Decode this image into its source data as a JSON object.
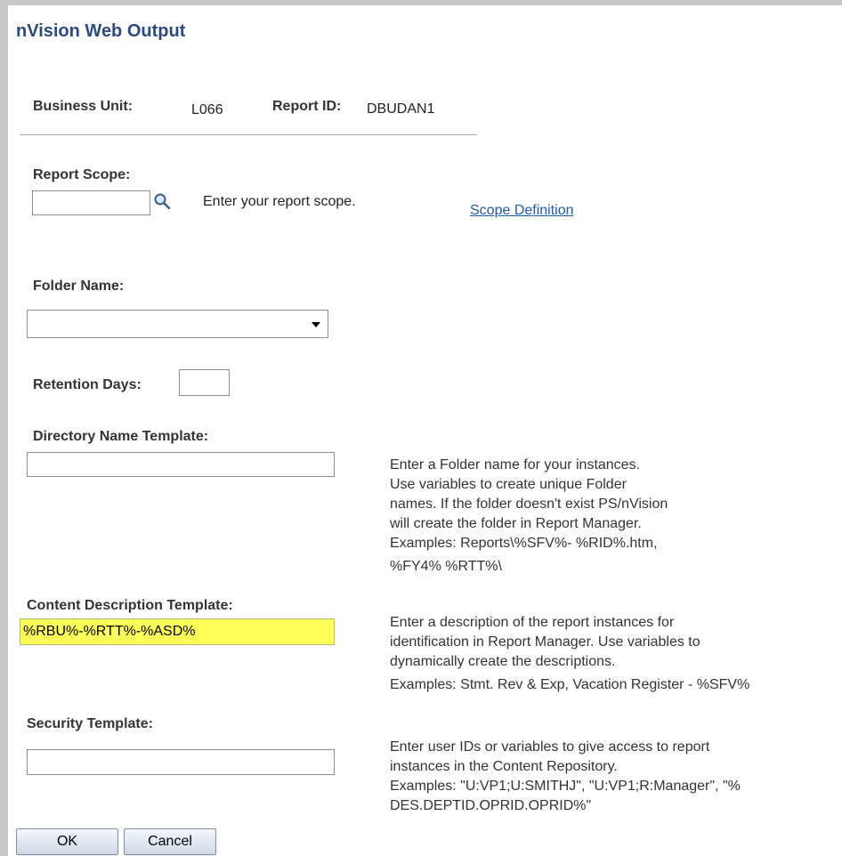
{
  "page": {
    "title": "nVision Web Output"
  },
  "header": {
    "business_unit_label": "Business Unit:",
    "business_unit_value": "L066",
    "report_id_label": "Report ID:",
    "report_id_value": "DBUDAN1"
  },
  "report_scope": {
    "label": "Report Scope:",
    "value": "",
    "hint": "Enter your report scope.",
    "link": "Scope Definition"
  },
  "folder_name": {
    "label": "Folder Name:",
    "selected": ""
  },
  "retention_days": {
    "label": "Retention Days:",
    "value": ""
  },
  "directory_template": {
    "label": "Directory Name Template:",
    "value": "",
    "help": [
      "Enter a Folder name for your instances.",
      "Use variables to create unique Folder",
      "names. If the folder doesn't exist PS/nVision",
      "will create the folder in Report Manager.",
      "Examples: Reports\\%SFV%- %RID%.htm,",
      "%FY4% %RTT%\\"
    ]
  },
  "content_description_template": {
    "label": "Content Description Template:",
    "value": "%RBU%-%RTT%-%ASD%",
    "help": [
      "Enter a description of the report instances for",
      "identification in Report Manager. Use variables to",
      "dynamically create the descriptions.",
      "Examples: Stmt. Rev & Exp, Vacation Register - %SFV%"
    ]
  },
  "security_template": {
    "label": "Security Template:",
    "value": "",
    "help": [
      "Enter user IDs or variables to give access to report",
      "instances in the Content Repository.",
      "Examples: \"U:VP1;U:SMITHJ\", \"U:VP1;R:Manager\", \"%",
      "DES.DEPTID.OPRID.OPRID%\""
    ]
  },
  "buttons": {
    "ok": "OK",
    "cancel": "Cancel"
  },
  "icons": {
    "lookup": "magnifier-icon",
    "dropdown": "chevron-down-icon"
  },
  "colors": {
    "title": "#2c4a7c",
    "link": "#1f5aa8",
    "highlight": "#ffff5a"
  }
}
